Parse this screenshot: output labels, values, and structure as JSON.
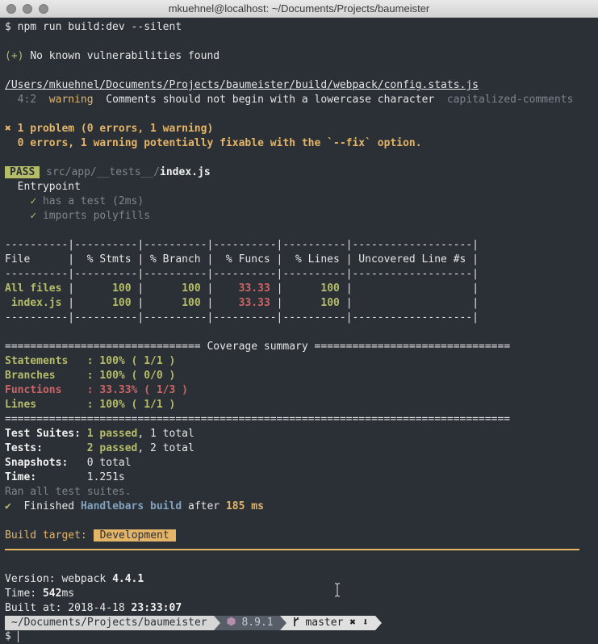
{
  "window": {
    "title": "mkuehnel@localhost: ~/Documents/Projects/baumeister"
  },
  "command": {
    "prompt": "$",
    "text": "npm run build:dev --silent"
  },
  "audit": {
    "prefix": "(+)",
    "message": "No known vulnerabilities found"
  },
  "lint": {
    "file": "/Users/mkuehnel/Documents/Projects/baumeister/build/webpack/config.stats.js",
    "location": "4:2",
    "level": "warning",
    "message": "Comments should not begin with a lowercase character",
    "rule": "capitalized-comments",
    "problem_symbol": "✖",
    "problem_summary": "1 problem (0 errors, 1 warning)",
    "fixable": "0 errors, 1 warning potentially fixable with the `--fix` option."
  },
  "tests": {
    "badge": "PASS",
    "path": "src/app/__tests__/",
    "file": "index.js",
    "suite": "Entrypoint",
    "check_symbol": "✓",
    "cases": [
      "has a test (2ms)",
      "imports polyfills"
    ]
  },
  "coverage_table": {
    "separator": "----------|----------|----------|----------|----------|-------------------|",
    "header": "File      |  % Stmts | % Branch |  % Funcs |  % Lines | Uncovered Line #s |",
    "rows": [
      {
        "file": "All files",
        "stmts": "100",
        "branch": "100",
        "funcs": "33.33",
        "lines": "100"
      },
      {
        "file": " index.js",
        "stmts": "100",
        "branch": "100",
        "funcs": "33.33",
        "lines": "100"
      }
    ]
  },
  "coverage_summary": {
    "left_rule": "=============================== ",
    "title": "Coverage summary",
    "right_rule": " ===============================",
    "bottom_rule": "================================================================================",
    "rows": [
      {
        "label": "Statements",
        "value": ": 100% ( 1/1 )"
      },
      {
        "label": "Branches",
        "value": ": 100% ( 0/0 )"
      },
      {
        "label": "Functions",
        "value": ": 33.33% ( 1/3 )"
      },
      {
        "label": "Lines",
        "value": ": 100% ( 1/1 )"
      }
    ]
  },
  "results": {
    "suites_label": "Test Suites:",
    "suites_passed": "1 passed",
    "suites_total": ", 1 total",
    "tests_label": "Tests:",
    "tests_passed": "2 passed",
    "tests_total": ", 2 total",
    "snapshots_label": "Snapshots:",
    "snapshots_value": "0 total",
    "time_label": "Time:",
    "time_value": "1.251s",
    "ran_all": "Ran all test suites."
  },
  "finished": {
    "symbol": "✔",
    "text1": "Finished ",
    "task": "Handlebars build",
    "text2": " after ",
    "duration": "185 ms"
  },
  "build": {
    "label": "Build target:",
    "target": "Development"
  },
  "webpack": {
    "version_label": "Version: webpack ",
    "version": "4.4.1",
    "time_label": "Time: ",
    "time": "542",
    "time_unit": "ms",
    "built_label": "Built at: 2018-4-18 ",
    "built_time": "23:33:07"
  },
  "prompt_bar": {
    "path": "~/Documents/Projects/baumeister",
    "node_icon": "node-hexagon-icon",
    "node_version": "8.9.1",
    "branch_icon": "git-branch-icon",
    "branch": "master",
    "dirty": "✖",
    "behind": "⬇",
    "prompt": "$"
  },
  "colors": {
    "background": "#2b2f36",
    "green": "#b5bd68",
    "red": "#cc6666",
    "yellow": "#e5b567",
    "cyan": "#81a2be"
  }
}
